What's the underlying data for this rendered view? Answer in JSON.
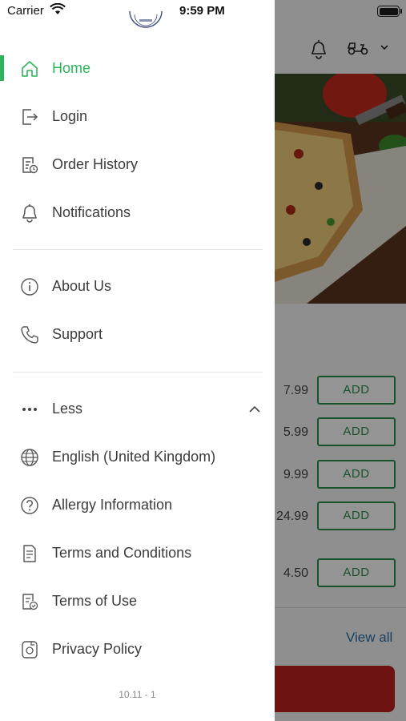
{
  "status_bar": {
    "carrier": "Carrier",
    "time": "9:59 PM"
  },
  "drawer": {
    "menu_primary": [
      {
        "label": "Home",
        "icon": "home-icon",
        "active": true
      },
      {
        "label": "Login",
        "icon": "login-icon",
        "active": false
      },
      {
        "label": "Order History",
        "icon": "order-history-icon",
        "active": false
      },
      {
        "label": "Notifications",
        "icon": "bell-icon",
        "active": false
      }
    ],
    "menu_secondary": [
      {
        "label": "About Us",
        "icon": "info-icon"
      },
      {
        "label": "Support",
        "icon": "phone-icon"
      }
    ],
    "more_toggle": {
      "label": "Less",
      "icon": "more-dots-icon",
      "expanded": true
    },
    "menu_more": [
      {
        "label": "English (United Kingdom)",
        "icon": "globe-icon"
      },
      {
        "label": "Allergy Information",
        "icon": "question-circle-icon"
      },
      {
        "label": "Terms and Conditions",
        "icon": "document-icon"
      },
      {
        "label": "Terms of Use",
        "icon": "document-check-icon"
      },
      {
        "label": "Privacy Policy",
        "icon": "privacy-icon"
      }
    ],
    "version": "10.11 - 1",
    "accent_color": "#2db35c"
  },
  "background": {
    "items": [
      {
        "price": "7.99",
        "button": "ADD"
      },
      {
        "price": "5.99",
        "button": "ADD"
      },
      {
        "price": "9.99",
        "button": "ADD"
      },
      {
        "price": "24.99",
        "button": "ADD"
      },
      {
        "price": "4.50",
        "button": "ADD"
      }
    ],
    "view_all": "View all",
    "accent_color": "#2a8f4c",
    "cta_color": "#c0201f"
  }
}
